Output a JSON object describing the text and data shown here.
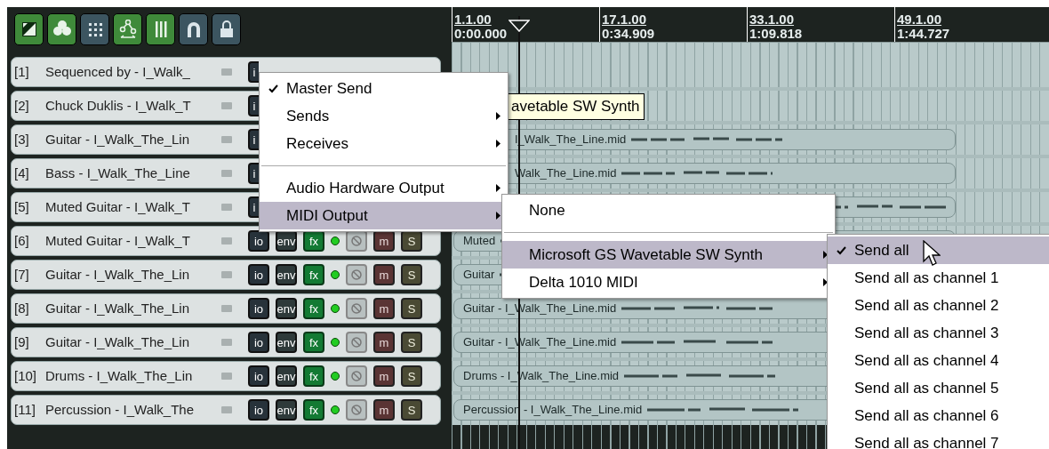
{
  "toolbar": [
    {
      "on": true
    },
    {
      "on": true
    },
    {
      "on": false
    },
    {
      "on": true
    },
    {
      "on": true
    },
    {
      "on": false
    },
    {
      "on": false
    }
  ],
  "ruler": [
    {
      "bar": "1.1.00",
      "time": "0:00.000"
    },
    {
      "bar": "17.1.00",
      "time": "0:34.909"
    },
    {
      "bar": "33.1.00",
      "time": "1:09.818"
    },
    {
      "bar": "49.1.00",
      "time": "1:44.727"
    }
  ],
  "tracks": [
    {
      "number": "[1]",
      "name": "Sequenced by - I_Walk_",
      "controls": [
        {
          "kind": "io-partial",
          "label": "i"
        }
      ]
    },
    {
      "number": "[2]",
      "name": "Chuck Duklis - I_Walk_T",
      "controls": [
        {
          "kind": "io-partial",
          "label": "i"
        }
      ]
    },
    {
      "number": "[3]",
      "name": "Guitar - I_Walk_The_Lin",
      "controls": [
        {
          "kind": "io-partial",
          "label": "i"
        }
      ],
      "item": {
        "label": "I_Walk_The_Line.mid",
        "covered": true
      }
    },
    {
      "number": "[4]",
      "name": "Bass - I_Walk_The_Line",
      "controls": [
        {
          "kind": "io-partial",
          "label": "i"
        }
      ],
      "item": {
        "label": "Walk_The_Line.mid",
        "covered": true
      }
    },
    {
      "number": "[5]",
      "name": "Muted Guitar - I_Walk_T",
      "controls": [
        {
          "kind": "io-partial",
          "label": "i"
        }
      ],
      "item": {
        "kind": "midi"
      }
    },
    {
      "number": "[6]",
      "name": "Muted Guitar - I_Walk_T",
      "controls": [
        {
          "kind": "io",
          "label": "io"
        },
        {
          "kind": "env",
          "label": "env"
        },
        {
          "kind": "fx",
          "label": "fx"
        },
        {
          "kind": "led"
        },
        {
          "kind": "phase"
        },
        {
          "kind": "mute",
          "label": "m"
        },
        {
          "kind": "solo",
          "label": "S"
        }
      ],
      "item": {
        "label": "Muted",
        "covered": false
      }
    },
    {
      "number": "[7]",
      "name": "Guitar - I_Walk_The_Lin",
      "controls": [
        {
          "kind": "io",
          "label": "io"
        },
        {
          "kind": "env",
          "label": "env"
        },
        {
          "kind": "fx",
          "label": "fx"
        },
        {
          "kind": "led"
        },
        {
          "kind": "phase"
        },
        {
          "kind": "mute",
          "label": "m"
        },
        {
          "kind": "solo",
          "label": "S"
        }
      ],
      "item": {
        "label": "Guitar",
        "covered": false
      }
    },
    {
      "number": "[8]",
      "name": "Guitar - I_Walk_The_Lin",
      "controls": [
        {
          "kind": "io",
          "label": "io"
        },
        {
          "kind": "env",
          "label": "env"
        },
        {
          "kind": "fx",
          "label": "fx"
        },
        {
          "kind": "led"
        },
        {
          "kind": "phase"
        },
        {
          "kind": "mute",
          "label": "m"
        },
        {
          "kind": "solo",
          "label": "S"
        }
      ],
      "item": {
        "label": "Guitar - I_Walk_The_Line.mid",
        "covered": false
      }
    },
    {
      "number": "[9]",
      "name": "Guitar - I_Walk_The_Lin",
      "controls": [
        {
          "kind": "io",
          "label": "io"
        },
        {
          "kind": "env",
          "label": "env"
        },
        {
          "kind": "fx",
          "label": "fx"
        },
        {
          "kind": "led"
        },
        {
          "kind": "phase"
        },
        {
          "kind": "mute",
          "label": "m"
        },
        {
          "kind": "solo",
          "label": "S"
        }
      ],
      "item": {
        "label": "Guitar - I_Walk_The_Line.mid",
        "covered": false
      }
    },
    {
      "number": "[10]",
      "name": "Drums - I_Walk_The_Lin",
      "controls": [
        {
          "kind": "io",
          "label": "io"
        },
        {
          "kind": "env",
          "label": "env"
        },
        {
          "kind": "fx",
          "label": "fx"
        },
        {
          "kind": "led"
        },
        {
          "kind": "phase"
        },
        {
          "kind": "mute",
          "label": "m"
        },
        {
          "kind": "solo",
          "label": "S"
        }
      ],
      "item": {
        "label": "Drums - I_Walk_The_Line.mid",
        "covered": false
      }
    },
    {
      "number": "[11]",
      "name": "Percussion - I_Walk_The",
      "controls": [
        {
          "kind": "io",
          "label": "io"
        },
        {
          "kind": "env",
          "label": "env"
        },
        {
          "kind": "fx",
          "label": "fx"
        },
        {
          "kind": "led"
        },
        {
          "kind": "phase"
        },
        {
          "kind": "mute",
          "label": "m"
        },
        {
          "kind": "solo",
          "label": "S"
        }
      ],
      "item": {
        "label": "Percussion - I_Walk_The_Line.mid",
        "covered": false
      }
    }
  ],
  "tooltip": "avetable SW Synth",
  "menus": [
    {
      "items": [
        {
          "kind": "item",
          "label": "Master Send",
          "checked": true,
          "submenu": false,
          "selected": false
        },
        {
          "kind": "item",
          "label": "Sends",
          "checked": false,
          "submenu": true,
          "selected": false
        },
        {
          "kind": "item",
          "label": "Receives",
          "checked": false,
          "submenu": true,
          "selected": false
        },
        {
          "kind": "separator"
        },
        {
          "kind": "item",
          "label": "Audio Hardware Output",
          "checked": false,
          "submenu": true,
          "selected": false
        },
        {
          "kind": "item",
          "label": "MIDI Output",
          "checked": false,
          "submenu": true,
          "selected": true
        }
      ]
    },
    {
      "items": [
        {
          "kind": "item",
          "label": "None",
          "checked": false,
          "submenu": false,
          "selected": false
        },
        {
          "kind": "separator"
        },
        {
          "kind": "item",
          "label": "Microsoft GS Wavetable SW Synth",
          "checked": false,
          "submenu": true,
          "selected": true
        },
        {
          "kind": "item",
          "label": "Delta 1010 MIDI",
          "checked": false,
          "submenu": true,
          "selected": false
        }
      ]
    },
    {
      "items": [
        {
          "kind": "item",
          "label": "Send all",
          "checked": true,
          "submenu": false,
          "selected": true
        },
        {
          "kind": "item",
          "label": "Send all as channel 1",
          "checked": false,
          "submenu": false,
          "selected": false
        },
        {
          "kind": "item",
          "label": "Send all as channel 2",
          "checked": false,
          "submenu": false,
          "selected": false
        },
        {
          "kind": "item",
          "label": "Send all as channel 3",
          "checked": false,
          "submenu": false,
          "selected": false
        },
        {
          "kind": "item",
          "label": "Send all as channel 4",
          "checked": false,
          "submenu": false,
          "selected": false
        },
        {
          "kind": "item",
          "label": "Send all as channel 5",
          "checked": false,
          "submenu": false,
          "selected": false
        },
        {
          "kind": "item",
          "label": "Send all as channel 6",
          "checked": false,
          "submenu": false,
          "selected": false
        },
        {
          "kind": "item",
          "label": "Send all as channel 7",
          "checked": false,
          "submenu": false,
          "selected": false
        }
      ]
    }
  ]
}
